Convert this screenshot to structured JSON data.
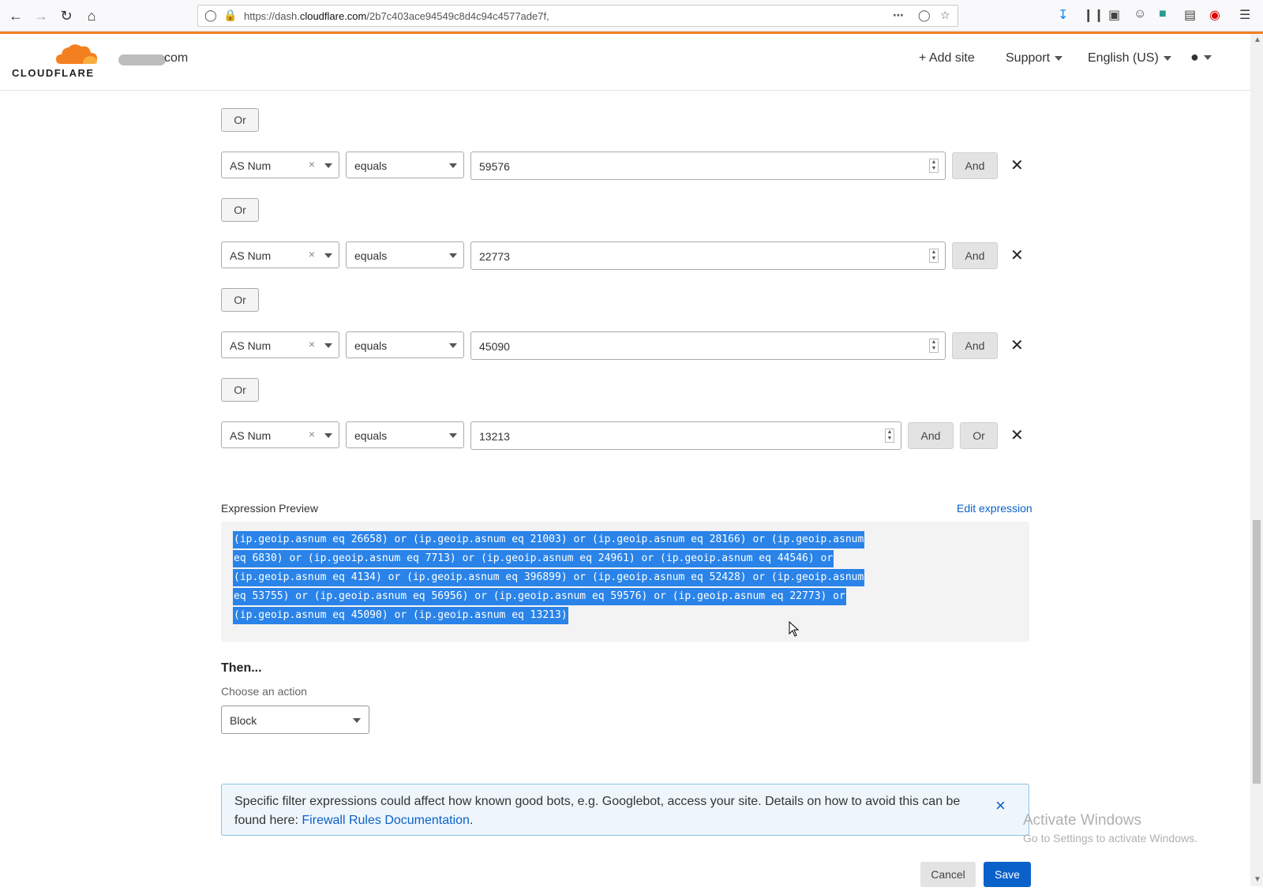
{
  "browser": {
    "url_prefix": "https://dash.",
    "url_domain": "cloudflare.com",
    "url_path": "/2b7c403ace94549c8d4c94c4577ade7f,"
  },
  "header": {
    "logo_text": "CLOUDFLARE",
    "domain_suffix": "com",
    "add_site": "Add site",
    "support": "Support",
    "language": "English (US)"
  },
  "rules": {
    "or_label": "Or",
    "and_label": "And",
    "rows": [
      {
        "field": "AS Num",
        "operator": "equals",
        "value": "59576"
      },
      {
        "field": "AS Num",
        "operator": "equals",
        "value": "22773"
      },
      {
        "field": "AS Num",
        "operator": "equals",
        "value": "45090"
      },
      {
        "field": "AS Num",
        "operator": "equals",
        "value": "13213"
      }
    ]
  },
  "expression": {
    "label": "Expression Preview",
    "edit_link": "Edit expression",
    "lines": [
      "(ip.geoip.asnum eq 26658) or (ip.geoip.asnum eq 21003) or (ip.geoip.asnum eq 28166) or (ip.geoip.asnum",
      "eq 6830) or (ip.geoip.asnum eq 7713) or (ip.geoip.asnum eq 24961) or (ip.geoip.asnum eq 44546) or",
      "(ip.geoip.asnum eq 4134) or (ip.geoip.asnum eq 396899) or (ip.geoip.asnum eq 52428) or (ip.geoip.asnum",
      "eq 53755) or (ip.geoip.asnum eq 56956) or (ip.geoip.asnum eq 59576) or (ip.geoip.asnum eq 22773) or",
      "(ip.geoip.asnum eq 45090) or (ip.geoip.asnum eq 13213)"
    ]
  },
  "then": {
    "title": "Then...",
    "choose_label": "Choose an action",
    "action": "Block"
  },
  "notice": {
    "text": "Specific filter expressions could affect how known good bots, e.g. Googlebot, access your site. Details on how to avoid this can be found here: ",
    "link": "Firewall Rules Documentation",
    "period": "."
  },
  "watermark": {
    "line1": "Activate Windows",
    "line2": "Go to Settings to activate Windows."
  },
  "footer": {
    "cancel": "Cancel",
    "save": "Save"
  },
  "colors": {
    "brand_orange": "#f38020",
    "link_blue": "#0a61c9",
    "selection_blue": "#2a83e8"
  }
}
